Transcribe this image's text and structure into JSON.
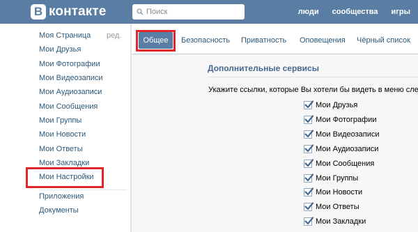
{
  "header": {
    "logo_badge": "В",
    "logo_text": "контакте",
    "search_placeholder": "Поиск",
    "nav": [
      "люди",
      "сообщества",
      "игры"
    ]
  },
  "left_menu": {
    "items": [
      "Моя Страница",
      "Мои Друзья",
      "Мои Фотографии",
      "Мои Видеозаписи",
      "Мои Аудиозаписи",
      "Мои Сообщения",
      "Мои Группы",
      "Мои Новости",
      "Мои Ответы",
      "Мои Закладки",
      "Мои Настройки"
    ],
    "edit_label": "ред.",
    "extra_items": [
      "Приложения",
      "Документы"
    ]
  },
  "tabs": {
    "active": "Общее",
    "others": [
      "Безопасность",
      "Приватность",
      "Оповещения",
      "Чёрный список"
    ]
  },
  "settings": {
    "section_title": "Дополнительные сервисы",
    "hint": "Укажите ссылки, которые Вы хотели бы видеть в меню слева",
    "options": [
      {
        "label": "Мои Друзья",
        "checked": true
      },
      {
        "label": "Мои Фотографии",
        "checked": true
      },
      {
        "label": "Мои Видеозаписи",
        "checked": true
      },
      {
        "label": "Мои Аудиозаписи",
        "checked": true
      },
      {
        "label": "Мои Сообщения",
        "checked": true
      },
      {
        "label": "Мои Группы",
        "checked": true
      },
      {
        "label": "Мои Новости",
        "checked": true
      },
      {
        "label": "Мои Ответы",
        "checked": true
      },
      {
        "label": "Мои Закладки",
        "checked": true
      }
    ]
  },
  "colors": {
    "header_bg": "#597da3",
    "link": "#2b587a",
    "highlight": "#e3262b"
  }
}
